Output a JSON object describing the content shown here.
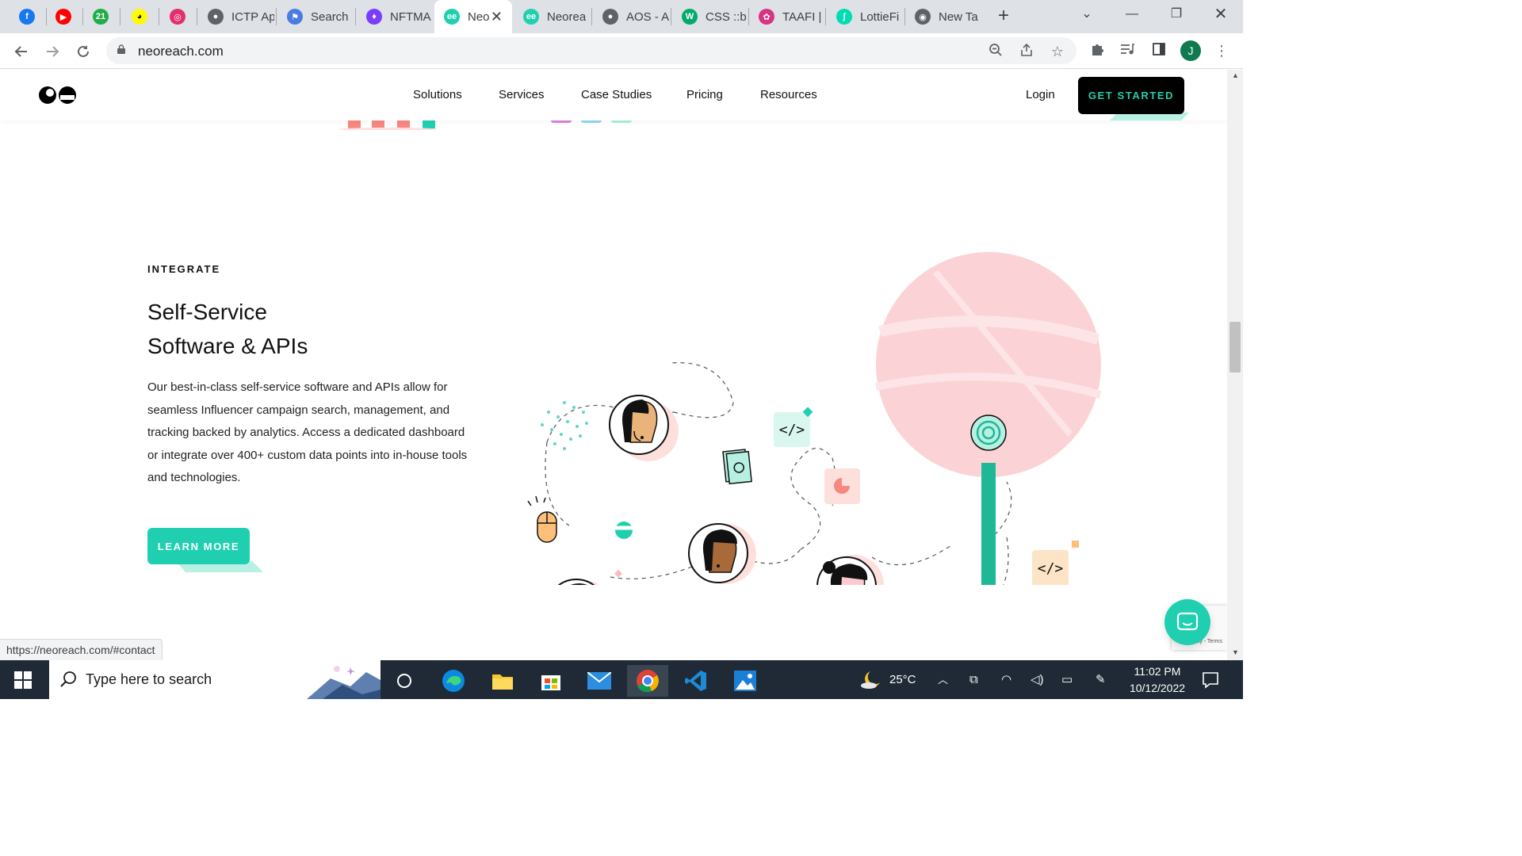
{
  "browser": {
    "tabs": [
      {
        "title": "",
        "icon": "facebook-icon",
        "color": "#1877f2",
        "glyph": "f"
      },
      {
        "title": "",
        "icon": "youtube-icon",
        "color": "#ff0000",
        "glyph": "▶"
      },
      {
        "title": "",
        "icon": "21-icon",
        "color": "#1fae48",
        "glyph": "21"
      },
      {
        "title": "",
        "icon": "snapchat-icon",
        "color": "#fffc00",
        "glyph": "◕"
      },
      {
        "title": "",
        "icon": "instagram-icon",
        "color": "#e1306c",
        "glyph": "◎"
      },
      {
        "title": "ICTP Ap",
        "icon": "globe-icon",
        "color": "#5f6368",
        "glyph": "●"
      },
      {
        "title": "Search",
        "icon": "flag-icon",
        "color": "#4a7be0",
        "glyph": "⚑"
      },
      {
        "title": "NFTMA",
        "icon": "flame-icon",
        "color": "#7a3cff",
        "glyph": "♦"
      },
      {
        "title": "Neo",
        "icon": "neoreach-icon",
        "color": "#1fcfb0",
        "glyph": "ee",
        "active": true
      },
      {
        "title": "Neorea",
        "icon": "neoreach-icon",
        "color": "#1fcfb0",
        "glyph": "ee"
      },
      {
        "title": "AOS - A",
        "icon": "globe-icon",
        "color": "#5f6368",
        "glyph": "●"
      },
      {
        "title": "CSS ::be",
        "icon": "w3-icon",
        "color": "#04aa6d",
        "glyph": "W"
      },
      {
        "title": "TAAFI |",
        "icon": "taafi-icon",
        "color": "#d63384",
        "glyph": "✿"
      },
      {
        "title": "LottieFi",
        "icon": "lottie-icon",
        "color": "#00ddb3",
        "glyph": "ʃ"
      },
      {
        "title": "New Ta",
        "icon": "chrome-icon",
        "color": "#5f6368",
        "glyph": "◉"
      }
    ],
    "url": "neoreach.com",
    "profile_initial": "J",
    "status_url": "https://neoreach.com/#contact"
  },
  "site": {
    "nav": [
      "Solutions",
      "Services",
      "Case Studies",
      "Pricing",
      "Resources"
    ],
    "login": "Login",
    "cta": "GET STARTED"
  },
  "section": {
    "eyebrow": "INTEGRATE",
    "headline_line1": "Self-Service",
    "headline_line2": "Software & APIs",
    "body": "Our best-in-class self-service software and APIs allow for seamless Influencer campaign search, management, and tracking backed by analytics. Access a dedicated dashboard or integrate over 400+ custom data points into in-house tools and technologies.",
    "learn_more": "LEARN MORE",
    "code_glyph": "</>"
  },
  "recaptcha_text": "Privacy - Terms",
  "taskbar": {
    "search_placeholder": "Type here to search",
    "temperature": "25°C",
    "time": "11:02 PM",
    "date": "10/12/2022"
  },
  "colors": {
    "accent": "#1fcfb0",
    "cta_text": "#1fd1ad",
    "salmon": "#f7877f",
    "pink_blob": "#fbd3d6"
  }
}
